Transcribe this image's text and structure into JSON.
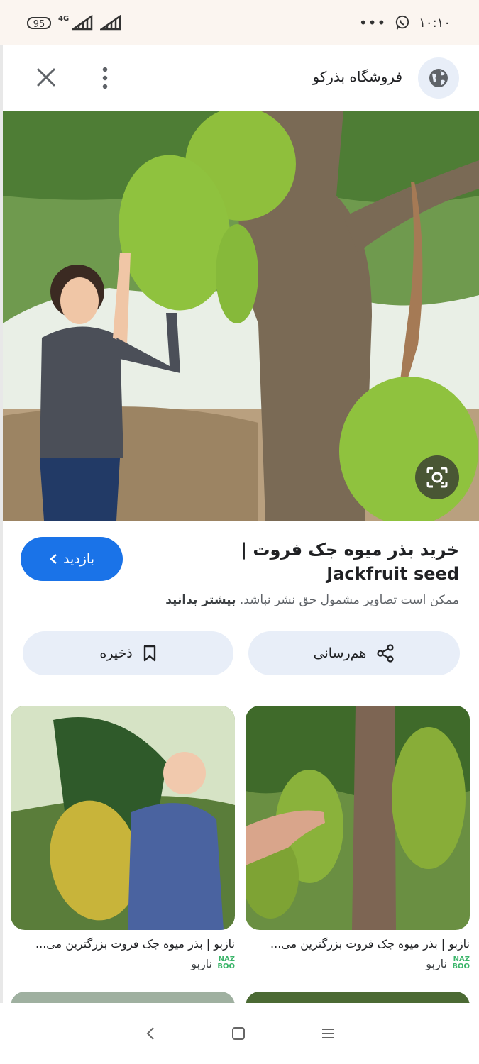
{
  "status_bar": {
    "battery": "95",
    "network": "4G",
    "time": "۱۰:۱۰",
    "more": "•••"
  },
  "header": {
    "site_name": "فروشگاه بذرکو"
  },
  "result": {
    "title": "خرید بذر میوه جک فروت | Jackfruit seed",
    "visit_label": "بازدید",
    "copyright_text": "ممکن است تصاویر مشمول حق نشر نباشد.",
    "learn_more": "بیشتر بدانید",
    "share_label": "هم‌رسانی",
    "save_label": "ذخیره"
  },
  "related": [
    {
      "caption": "نازبو | بذر میوه جک فروت بزرگترین می...",
      "source": "نازبو",
      "watermark": "NAZBOO"
    },
    {
      "caption": "نازبو | بذر میوه جک فروت بزرگترین می...",
      "source": "نازبو"
    }
  ],
  "colors": {
    "accent": "#1a73e8",
    "chip_bg": "#e8eef8",
    "status_bg": "#fbf5f0"
  }
}
